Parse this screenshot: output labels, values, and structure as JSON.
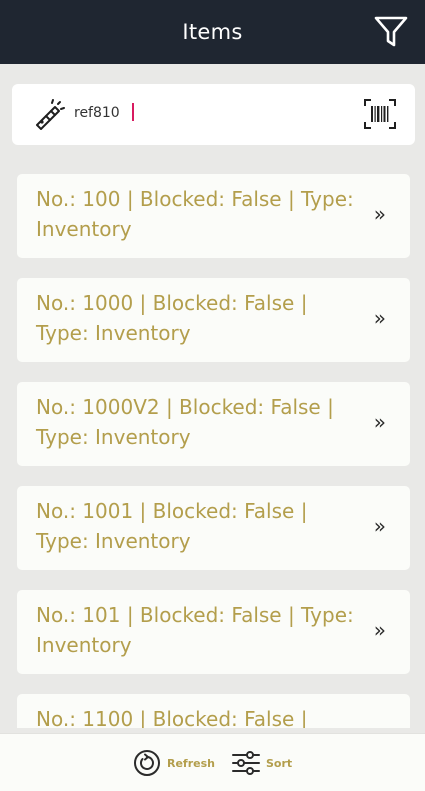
{
  "header": {
    "title": "Items",
    "filter_icon": "filter-icon"
  },
  "search": {
    "value": "ref810",
    "left_icon": "flashlight-icon",
    "right_icon": "barcode-scan-icon"
  },
  "items": [
    {
      "text": "No.: 100 | Blocked: False | Type: Inventory"
    },
    {
      "text": "No.: 1000 | Blocked: False | Type: Inventory"
    },
    {
      "text": "No.: 1000V2 | Blocked: False | Type: Inventory"
    },
    {
      "text": "No.: 1001 | Blocked: False | Type: Inventory"
    },
    {
      "text": "No.: 101 | Blocked: False | Type: Inventory"
    },
    {
      "text": "No.: 1100 | Blocked: False |"
    }
  ],
  "item_chevron": "»",
  "bottom": {
    "refresh_label": "Refresh",
    "sort_label": "Sort",
    "refresh_icon": "refresh-icon",
    "sort_icon": "sliders-icon"
  },
  "colors": {
    "header_bg": "#1f2631",
    "accent_text": "#b39e4c",
    "background": "#e9e9e7",
    "card": "#fbfcf9",
    "caret": "#d81b60"
  }
}
